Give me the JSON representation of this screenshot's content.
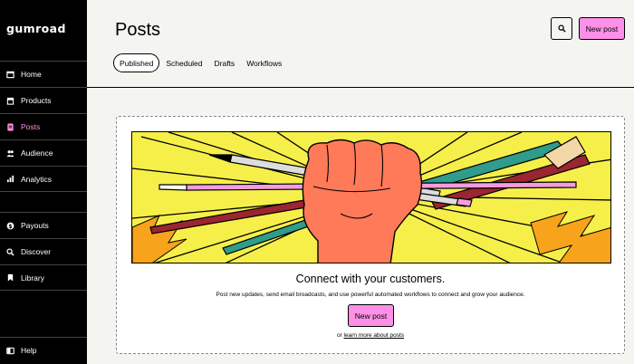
{
  "brand": {
    "logo_text": "GUMROAD"
  },
  "sidebar": {
    "items": [
      {
        "label": "Home",
        "icon": "home-icon"
      },
      {
        "label": "Products",
        "icon": "archive-icon"
      },
      {
        "label": "Posts",
        "icon": "posts-icon",
        "active": true
      },
      {
        "label": "Audience",
        "icon": "people-icon"
      },
      {
        "label": "Analytics",
        "icon": "bar-chart-icon"
      },
      {
        "label": "Payouts",
        "icon": "dollar-icon"
      },
      {
        "label": "Discover",
        "icon": "search-icon"
      },
      {
        "label": "Library",
        "icon": "bookmark-icon"
      }
    ],
    "help": {
      "label": "Help",
      "icon": "help-icon"
    }
  },
  "header": {
    "title": "Posts",
    "new_post_label": "New post",
    "tabs": [
      "Published",
      "Scheduled",
      "Drafts",
      "Workflows"
    ],
    "active_tab": "Published"
  },
  "empty_state": {
    "title": "Connect with your customers.",
    "description": "Post new updates, send email broadcasts, and use powerful automated workflows to connect and grow your audience.",
    "button_label": "New post",
    "learn_prefix": "or",
    "learn_link": "learn more about posts"
  },
  "colors": {
    "accent_pink": "#ff90e8",
    "sidebar_bg": "#000000",
    "page_bg": "#f4f4f0",
    "illustration_yellow": "#f6ef4a",
    "fist_orange": "#ff7a59"
  }
}
